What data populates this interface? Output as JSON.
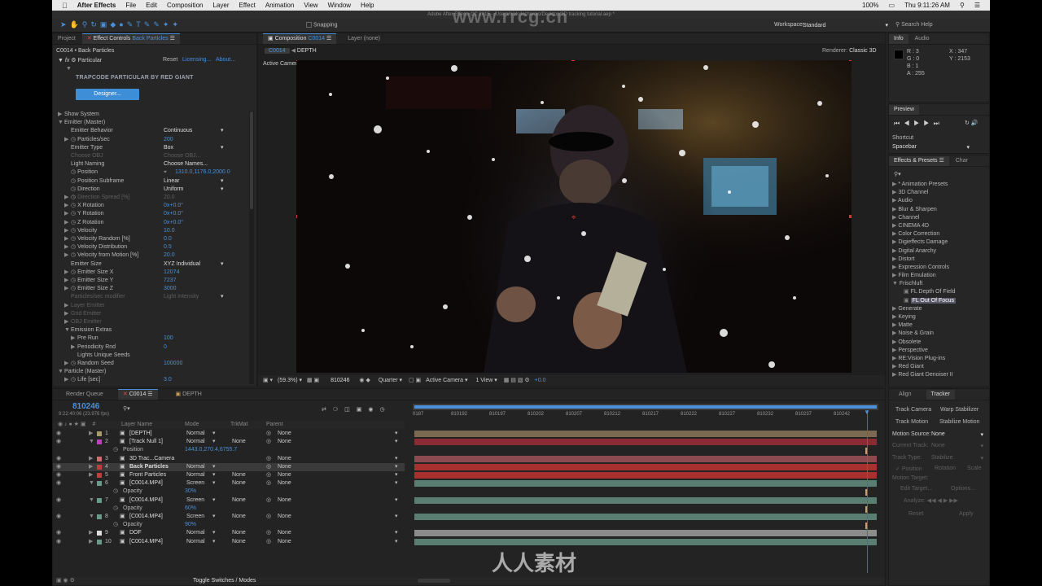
{
  "menubar": {
    "app": "After Effects",
    "items": [
      "File",
      "Edit",
      "Composition",
      "Layer",
      "Effect",
      "Animation",
      "View",
      "Window",
      "Help"
    ],
    "battery": "100%",
    "clock": "Thu 9:11:26 AM"
  },
  "titlebar": "Adobe After Effects CC 2015 - /Users/nickvloshenko/Desktop/3D tracking tutorial.aep *",
  "toolbar": {
    "snapping": "Snapping",
    "workspace_label": "Workspace:",
    "workspace": "Standard",
    "search": "Search Help"
  },
  "left": {
    "tab_project": "Project",
    "tab_effect": "Effect Controls",
    "tab_effect_layer": "Back Particles",
    "crumb": "C0014 • Back Particles",
    "fx_name": "Particular",
    "reset": "Reset",
    "licensing": "Licensing...",
    "about": "About...",
    "brand": "TRAPCODE PARTICULAR BY RED GIANT",
    "designer": "Designer...",
    "props": [
      {
        "t": "Show System",
        "v": "",
        "lvl": 1,
        "tw": "▶"
      },
      {
        "t": "Emitter (Master)",
        "v": "",
        "lvl": 1,
        "tw": "▼"
      },
      {
        "t": "Emitter Behavior",
        "v": "Continuous",
        "lvl": 2,
        "tw": "",
        "dd": true
      },
      {
        "t": "Particles/sec",
        "v": "200",
        "lvl": 2,
        "tw": "▶",
        "sw": true
      },
      {
        "t": "Emitter Type",
        "v": "Box",
        "lvl": 2,
        "tw": "",
        "dd": true
      },
      {
        "t": "Choose OBJ",
        "v": "Choose OBJ...",
        "lvl": 2,
        "tw": "",
        "dim": true
      },
      {
        "t": "Light Naming",
        "v": "Choose Names...",
        "lvl": 2,
        "tw": ""
      },
      {
        "t": "Position",
        "v": "1310.0,1176.0,2000.0",
        "lvl": 2,
        "tw": "",
        "sw": true,
        "pos": true
      },
      {
        "t": "Position Subframe",
        "v": "Linear",
        "lvl": 2,
        "tw": "",
        "sw": true,
        "dd": true
      },
      {
        "t": "Direction",
        "v": "Uniform",
        "lvl": 2,
        "tw": "",
        "sw": true,
        "dd": true
      },
      {
        "t": "Direction Spread [%]",
        "v": "20.0",
        "lvl": 2,
        "tw": "▶",
        "sw": true,
        "dim": true
      },
      {
        "t": "X Rotation",
        "v": "0x+0.0°",
        "lvl": 2,
        "tw": "▶",
        "sw": true
      },
      {
        "t": "Y Rotation",
        "v": "0x+0.0°",
        "lvl": 2,
        "tw": "▶",
        "sw": true
      },
      {
        "t": "Z Rotation",
        "v": "0x+0.0°",
        "lvl": 2,
        "tw": "▶",
        "sw": true
      },
      {
        "t": "Velocity",
        "v": "10.0",
        "lvl": 2,
        "tw": "▶",
        "sw": true
      },
      {
        "t": "Velocity Random [%]",
        "v": "0.0",
        "lvl": 2,
        "tw": "▶",
        "sw": true
      },
      {
        "t": "Velocity Distribution",
        "v": "0.5",
        "lvl": 2,
        "tw": "▶",
        "sw": true
      },
      {
        "t": "Velocity from Motion [%]",
        "v": "20.0",
        "lvl": 2,
        "tw": "▶",
        "sw": true
      },
      {
        "t": "Emitter Size",
        "v": "XYZ Individual",
        "lvl": 2,
        "tw": "",
        "dd": true
      },
      {
        "t": "Emitter Size X",
        "v": "12074",
        "lvl": 2,
        "tw": "▶",
        "sw": true
      },
      {
        "t": "Emitter Size Y",
        "v": "7237",
        "lvl": 2,
        "tw": "▶",
        "sw": true
      },
      {
        "t": "Emitter Size Z",
        "v": "3000",
        "lvl": 2,
        "tw": "▶",
        "sw": true
      },
      {
        "t": "Particles/sec modifier",
        "v": "Light Intensity",
        "lvl": 2,
        "tw": "",
        "dim": true,
        "dd": true
      },
      {
        "t": "Layer Emitter",
        "v": "",
        "lvl": 2,
        "tw": "▶",
        "dim": true
      },
      {
        "t": "Grid Emitter",
        "v": "",
        "lvl": 2,
        "tw": "▶",
        "dim": true
      },
      {
        "t": "OBJ Emitter",
        "v": "",
        "lvl": 2,
        "tw": "▶",
        "dim": true
      },
      {
        "t": "Emission Extras",
        "v": "",
        "lvl": 2,
        "tw": "▼"
      },
      {
        "t": "Pre Run",
        "v": "100",
        "lvl": 3,
        "tw": "▶"
      },
      {
        "t": "Periodicity Rnd",
        "v": "0",
        "lvl": 3,
        "tw": "▶"
      },
      {
        "t": "Lights Unique Seeds",
        "v": "",
        "lvl": 3,
        "tw": ""
      },
      {
        "t": "Random Seed",
        "v": "100000",
        "lvl": 2,
        "tw": "▶",
        "sw": true
      },
      {
        "t": "Particle (Master)",
        "v": "",
        "lvl": 1,
        "tw": "▼"
      },
      {
        "t": "Life [sec]",
        "v": "3.0",
        "lvl": 2,
        "tw": "▶",
        "sw": true
      }
    ]
  },
  "comp": {
    "tab": "Composition",
    "tab_name": "C0014",
    "tab_layer": "Layer (none)",
    "crumb1": "C0014",
    "crumb2": "DEPTH",
    "renderer_label": "Renderer:",
    "renderer": "Classic 3D",
    "camera": "Active Camera",
    "zoom": "(59.3%)",
    "frame": "810246",
    "resolution": "Quarter",
    "view_camera": "Active Camera",
    "views": "1 View",
    "exposure": "+0.0"
  },
  "right": {
    "tab_info": "Info",
    "tab_audio": "Audio",
    "info": {
      "r": "R : 3",
      "g": "G : 0",
      "b": "B : 1",
      "a": "A : 255",
      "x": "X : 347",
      "y": "Y : 2153"
    },
    "preview": "Preview",
    "shortcut_label": "Shortcut",
    "shortcut": "Spacebar",
    "tab_fx": "Effects & Presets",
    "tab_char": "Char",
    "fx_items": [
      {
        "t": "* Animation Presets",
        "open": false
      },
      {
        "t": "3D Channel",
        "open": false
      },
      {
        "t": "Audio",
        "open": false
      },
      {
        "t": "Blur & Sharpen",
        "open": false
      },
      {
        "t": "Channel",
        "open": false
      },
      {
        "t": "CINEMA 4D",
        "open": false
      },
      {
        "t": "Color Correction",
        "open": false
      },
      {
        "t": "Digieffects Damage",
        "open": false
      },
      {
        "t": "Digital Anarchy",
        "open": false
      },
      {
        "t": "Distort",
        "open": false
      },
      {
        "t": "Expression Controls",
        "open": false
      },
      {
        "t": "Film Emulation",
        "open": false
      },
      {
        "t": "Frischluft",
        "open": true
      },
      {
        "t": "FL Depth Of Field",
        "child": true
      },
      {
        "t": "FL Out Of Focus",
        "child": true,
        "sel": true
      },
      {
        "t": "Generate",
        "open": false
      },
      {
        "t": "Keying",
        "open": false
      },
      {
        "t": "Matte",
        "open": false
      },
      {
        "t": "Noise & Grain",
        "open": false
      },
      {
        "t": "Obsolete",
        "open": false
      },
      {
        "t": "Perspective",
        "open": false
      },
      {
        "t": "RE:Vision Plug-ins",
        "open": false
      },
      {
        "t": "Red Giant",
        "open": false
      },
      {
        "t": "Red Giant Denoiser II",
        "open": false
      }
    ]
  },
  "tracker": {
    "tab_align": "Align",
    "tab_tracker": "Tracker",
    "track_camera": "Track Camera",
    "warp": "Warp Stabilizer",
    "track_motion": "Track Motion",
    "stab_motion": "Stabilize Motion",
    "source_label": "Motion Source:",
    "source": "None",
    "current_label": "Current Track:",
    "current": "None",
    "type_label": "Track Type:",
    "type": "Stabilize",
    "position": "Position",
    "rotation": "Rotation",
    "scale": "Scale",
    "target_label": "Motion Target:",
    "edit_target": "Edit Target...",
    "options": "Options...",
    "analyze": "Analyze:",
    "reset": "Reset",
    "apply": "Apply"
  },
  "timeline": {
    "tab_render": "Render Queue",
    "tab_c0014": "C0014",
    "tab_depth": "DEPTH",
    "timecode": "810246",
    "sub_tc": "9:22:40:06 (23.976 fps)",
    "col_name": "Layer Name",
    "col_mode": "Mode",
    "col_trkmat": "TrkMat",
    "col_parent": "Parent",
    "toggle": "Toggle Switches / Modes",
    "ticks": [
      "0187",
      "810192",
      "810197",
      "810202",
      "810207",
      "810212",
      "810217",
      "810222",
      "810227",
      "810232",
      "810237",
      "810242"
    ],
    "layers": [
      {
        "num": "1",
        "name": "[DEPTH]",
        "mode": "Normal",
        "trk": "",
        "parent": "None",
        "color": "#a89a6a",
        "bar": "#7a6a52"
      },
      {
        "num": "2",
        "name": "[Track Null 1]",
        "mode": "Normal",
        "trk": "None",
        "parent": "None",
        "color": "#c040c0",
        "bar": "#8a2a34"
      },
      {
        "num": "",
        "name": "Position",
        "mode": "",
        "trk": "",
        "parent": "",
        "value": "1443.0,270.4,6755.7",
        "sub": true
      },
      {
        "num": "3",
        "name": "3D Trac...Camera",
        "mode": "",
        "trk": "",
        "parent": "None",
        "color": "#c87070",
        "bar": "#8a4a50"
      },
      {
        "num": "4",
        "name": "Back Particles",
        "mode": "Normal",
        "trk": "",
        "parent": "None",
        "color": "#c04040",
        "bar": "#a8302f",
        "sel": true
      },
      {
        "num": "5",
        "name": "Front Particles",
        "mode": "Normal",
        "trk": "None",
        "parent": "None",
        "color": "#c04040",
        "bar": "#a8302f"
      },
      {
        "num": "6",
        "name": "[C0014.MP4]",
        "mode": "Screen",
        "trk": "None",
        "parent": "None",
        "color": "#6a9a8a",
        "bar": "#5a7e72"
      },
      {
        "num": "",
        "name": "Opacity",
        "mode": "",
        "trk": "",
        "parent": "",
        "value": "30%",
        "sub": true
      },
      {
        "num": "7",
        "name": "[C0014.MP4]",
        "mode": "Screen",
        "trk": "None",
        "parent": "None",
        "color": "#6a9a8a",
        "bar": "#5a7e72"
      },
      {
        "num": "",
        "name": "Opacity",
        "mode": "",
        "trk": "",
        "parent": "",
        "value": "60%",
        "sub": true
      },
      {
        "num": "8",
        "name": "[C0014.MP4]",
        "mode": "Screen",
        "trk": "None",
        "parent": "None",
        "color": "#6a9a8a",
        "bar": "#5a7e72"
      },
      {
        "num": "",
        "name": "Opacity",
        "mode": "",
        "trk": "",
        "parent": "",
        "value": "90%",
        "sub": true
      },
      {
        "num": "9",
        "name": "DOF",
        "mode": "Normal",
        "trk": "None",
        "parent": "None",
        "color": "#ddd",
        "bar": "#8c8c8c"
      },
      {
        "num": "10",
        "name": "[C0014.MP4]",
        "mode": "Normal",
        "trk": "None",
        "parent": "None",
        "color": "#6a9a8a",
        "bar": "#5a7e72"
      }
    ]
  },
  "watermark": "www.rrcg.cn",
  "watermark2": "人人素材"
}
